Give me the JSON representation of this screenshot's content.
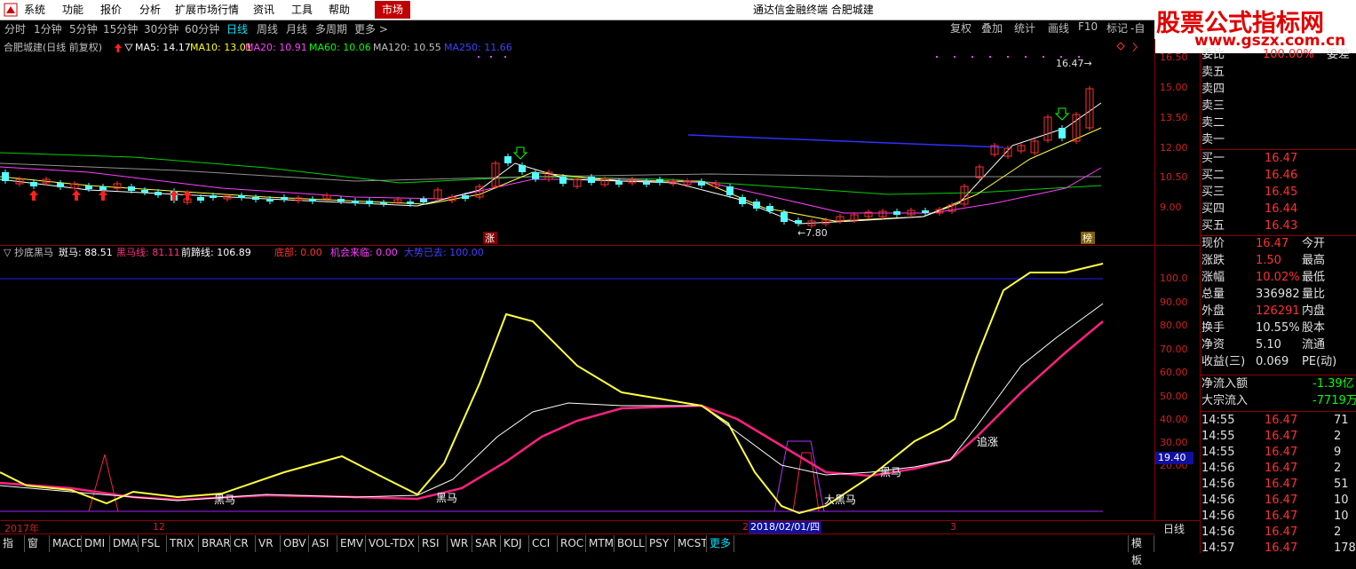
{
  "menubar": {
    "items": [
      "系统",
      "功能",
      "报价",
      "分析",
      "扩展市场行情",
      "资讯",
      "工具",
      "帮助"
    ],
    "market_button": "市场",
    "window_title": "通达信金融终端  合肥城建"
  },
  "toolbar": {
    "periods": [
      "分时",
      "1分钟",
      "5分钟",
      "15分钟",
      "30分钟",
      "60分钟",
      "日线",
      "周线",
      "月线",
      "多周期",
      "更多 >"
    ],
    "active": "日线",
    "right_buttons": [
      "复权",
      "叠加",
      "统计",
      "画线",
      "F10",
      "标记",
      "-自"
    ]
  },
  "watermark": {
    "line1": "股票公式指标网",
    "line2": "www.gszx.com.cn"
  },
  "main_chart": {
    "title": "合肥城建(日线 前复权)",
    "ma": [
      {
        "label": "MA5: 14.17",
        "color": "#ffffff"
      },
      {
        "label": "MA10: 13.01",
        "color": "#ffff00"
      },
      {
        "label": "MA20: 10.91",
        "color": "#ff40ff"
      },
      {
        "label": "MA60: 10.06",
        "color": "#00ff00"
      },
      {
        "label": "MA120: 10.55",
        "color": "#c0c0c0"
      },
      {
        "label": "MA250: 11.66",
        "color": "#4040ff"
      }
    ],
    "price_axis": [
      "16.50",
      "15.00",
      "13.50",
      "12.00",
      "10.50",
      "9.00"
    ],
    "high_label": "16.47",
    "low_label": "7.80",
    "tag_zhang": "涨",
    "tag_bang": "榜"
  },
  "sub_chart": {
    "title": "▽ 抄底黑马",
    "values": [
      {
        "label": "斑马: 88.51",
        "color": "#ffffff"
      },
      {
        "label": "黑马线: 81.11",
        "color": "#ff3080"
      },
      {
        "label": "前蹄线: 106.89",
        "color": "#ffffff"
      },
      {
        "label": "底部: 0.00",
        "color": "#ff3030"
      },
      {
        "label": "机会来临: 0.00",
        "color": "#ff40ff"
      },
      {
        "label": "大势已去: 100.00",
        "color": "#4040ff"
      }
    ],
    "axis": [
      "100.0",
      "90.00",
      "80.00",
      "70.00",
      "60.00",
      "50.00",
      "40.00",
      "30.00",
      "20.00"
    ],
    "cursor_value": "19.40",
    "annotations": [
      "黑马",
      "黑马",
      "黑马",
      "大黑马",
      "追涨"
    ]
  },
  "date_axis": {
    "labels": [
      "2017年",
      "12",
      "2",
      "3"
    ],
    "cursor_date": "2018/02/01/四",
    "period": "日线"
  },
  "bottom_tabs": {
    "items": [
      "指标",
      "窗口",
      "MACD",
      "DMI",
      "DMA",
      "FSL",
      "TRIX",
      "BRAR",
      "CR",
      "VR",
      "OBV",
      "ASI",
      "EMV",
      "VOL-TDX",
      "RSI",
      "WR",
      "SAR",
      "KDJ",
      "CCI",
      "ROC",
      "MTM",
      "BOLL",
      "PSY",
      "MCST"
    ],
    "more": "更多",
    "template": "模板"
  },
  "quote": {
    "top_label": "委比",
    "top_value": "100.00%",
    "top_label2": "委差",
    "sell": [
      {
        "name": "卖五"
      },
      {
        "name": "卖四"
      },
      {
        "name": "卖三"
      },
      {
        "name": "卖二"
      },
      {
        "name": "卖一"
      }
    ],
    "buy": [
      {
        "name": "买一",
        "price": "16.47"
      },
      {
        "name": "买二",
        "price": "16.46"
      },
      {
        "name": "买三",
        "price": "16.45"
      },
      {
        "name": "买四",
        "price": "16.44"
      },
      {
        "name": "买五",
        "price": "16.43"
      }
    ],
    "stats": [
      {
        "label": "现价",
        "value": "16.47",
        "label2": "今开",
        "color": "#ff3030"
      },
      {
        "label": "涨跌",
        "value": "1.50",
        "label2": "最高",
        "color": "#ff3030"
      },
      {
        "label": "涨幅",
        "value": "10.02%",
        "label2": "最低",
        "color": "#ff3030"
      },
      {
        "label": "总量",
        "value": "336982",
        "label2": "量比",
        "color": "#e0e0e0"
      },
      {
        "label": "外盘",
        "value": "126291",
        "label2": "内盘",
        "color": "#ff3030"
      },
      {
        "label": "换手",
        "value": "10.55%",
        "label2": "股本",
        "color": "#e0e0e0"
      },
      {
        "label": "净资",
        "value": "5.10",
        "label2": "流通",
        "color": "#e0e0e0"
      },
      {
        "label": "收益(三)",
        "value": "0.069",
        "label2": "PE(动)",
        "color": "#e0e0e0"
      }
    ],
    "flows": [
      {
        "label": "净流入额",
        "value": "-1.39亿"
      },
      {
        "label": "大宗流入",
        "value": "-7719万"
      }
    ],
    "ticks": [
      {
        "time": "14:55",
        "price": "16.47",
        "vol": "71"
      },
      {
        "time": "14:55",
        "price": "16.47",
        "vol": "2"
      },
      {
        "time": "14:55",
        "price": "16.47",
        "vol": "9"
      },
      {
        "time": "14:56",
        "price": "16.47",
        "vol": "2"
      },
      {
        "time": "14:56",
        "price": "16.47",
        "vol": "51"
      },
      {
        "time": "14:56",
        "price": "16.47",
        "vol": "10"
      },
      {
        "time": "14:56",
        "price": "16.47",
        "vol": "10"
      },
      {
        "time": "14:56",
        "price": "16.47",
        "vol": "2"
      },
      {
        "time": "14:57",
        "price": "16.47",
        "vol": "178"
      }
    ]
  }
}
